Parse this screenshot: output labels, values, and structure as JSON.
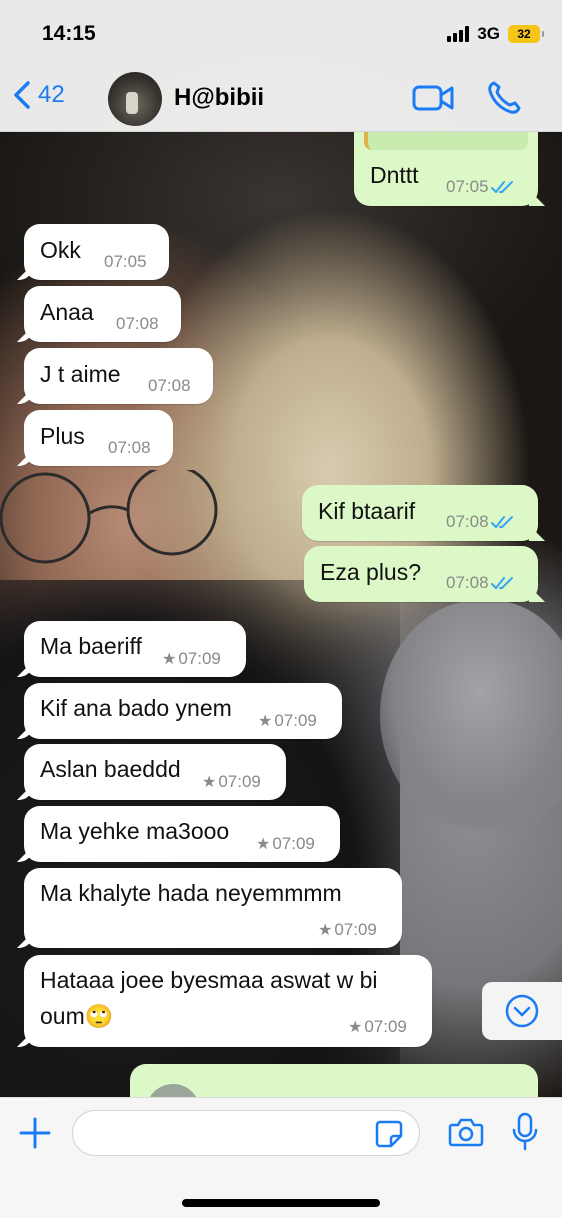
{
  "status": {
    "time": "14:15",
    "network": "3G",
    "battery": "32"
  },
  "header": {
    "back_count": "42",
    "contact_name": "H@bibii"
  },
  "messages": [
    {
      "dir": "out",
      "text": "Dnttt",
      "time": "07:05",
      "starred": false
    },
    {
      "dir": "in",
      "text": "Okk",
      "time": "07:05",
      "starred": false
    },
    {
      "dir": "in",
      "text": "Anaa",
      "time": "07:08",
      "starred": false
    },
    {
      "dir": "in",
      "text": "J t aime",
      "time": "07:08",
      "starred": false
    },
    {
      "dir": "in",
      "text": "Plus",
      "time": "07:08",
      "starred": false
    },
    {
      "dir": "out",
      "text": "Kif btaarif",
      "time": "07:08",
      "starred": false
    },
    {
      "dir": "out",
      "text": "Eza plus?",
      "time": "07:08",
      "starred": false
    },
    {
      "dir": "in",
      "text": "Ma baeriff",
      "time": "07:09",
      "starred": true
    },
    {
      "dir": "in",
      "text": "Kif ana bado ynem",
      "time": "07:09",
      "starred": true
    },
    {
      "dir": "in",
      "text": "Aslan baeddd",
      "time": "07:09",
      "starred": true
    },
    {
      "dir": "in",
      "text": "Ma yehke ma3ooo",
      "time": "07:09",
      "starred": true
    },
    {
      "dir": "in",
      "text": "Ma khalyte hada neyemmmm",
      "time": "07:09",
      "starred": true
    },
    {
      "dir": "in",
      "line1": "Hataaa joee byesmaa aswat w bi",
      "line2": "oum🙄",
      "time": "07:09",
      "starred": true
    }
  ],
  "star_symbol": "★",
  "colors": {
    "accent": "#1a7cf5",
    "outgoing_bubble": "#dcf8c6",
    "incoming_bubble": "#ffffff",
    "read_ticks": "#34a6f5"
  },
  "input": {
    "placeholder": ""
  }
}
